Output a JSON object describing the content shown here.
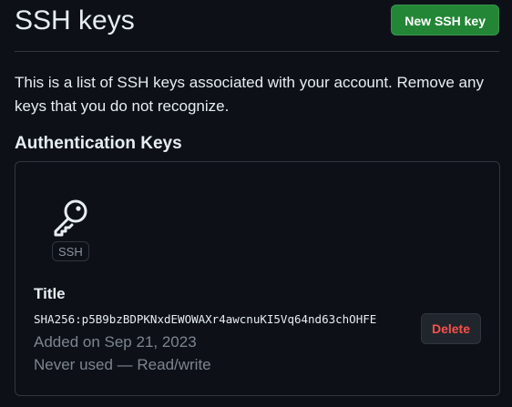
{
  "header": {
    "title": "SSH keys",
    "new_key_label": "New SSH key"
  },
  "description": "This is a list of SSH keys associated with your account. Remove any keys that you do not recognize.",
  "section": {
    "heading": "Authentication Keys"
  },
  "keys": [
    {
      "icon": "key-icon",
      "type_badge": "SSH",
      "title": "Title",
      "fingerprint": "SHA256:p5B9bzBDPKNxdEWOWAXr4awcnuKI5Vq64nd63chOHFE",
      "added": "Added on Sep 21, 2023",
      "usage": "Never used — Read/write",
      "delete_label": "Delete"
    }
  ],
  "colors": {
    "background": "#0d1117",
    "border": "#30363d",
    "primary_button": "#238636",
    "danger_text": "#f85149",
    "muted_text": "#7d8590",
    "text": "#e6edf3"
  }
}
